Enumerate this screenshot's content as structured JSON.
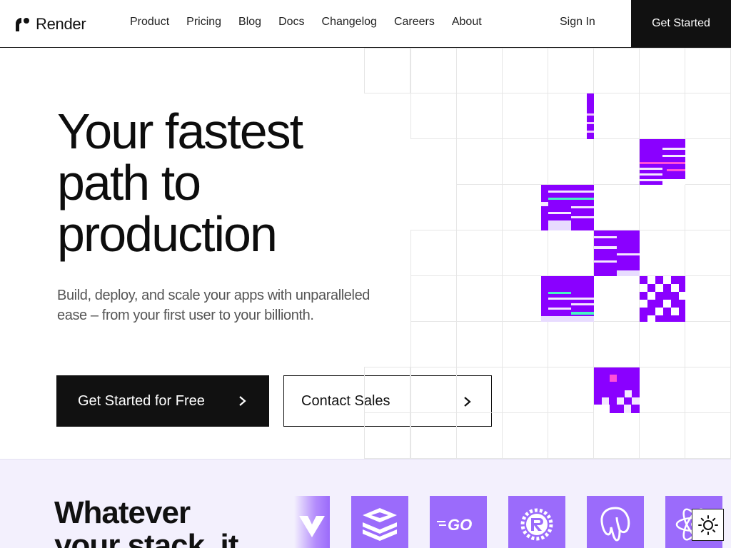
{
  "brand": {
    "name": "Render"
  },
  "nav": {
    "links": [
      "Product",
      "Pricing",
      "Blog",
      "Docs",
      "Changelog",
      "Careers",
      "About"
    ],
    "sign_in": "Sign In",
    "get_started": "Get Started"
  },
  "hero": {
    "title_lines": [
      "Your fastest",
      "path to",
      "production"
    ],
    "subtitle": "Build, deploy, and scale your apps with unparalleled ease – from your first user to your billionth.",
    "primary_cta": "Get Started for Free",
    "secondary_cta": "Contact Sales"
  },
  "stack": {
    "title_lines": [
      "Whatever",
      "your stack, it"
    ],
    "icons": [
      "vue-icon",
      "redis-icon",
      "go-icon",
      "rust-icon",
      "postgres-icon",
      "react-icon"
    ],
    "go_label": "GO"
  },
  "colors": {
    "accent": "#8a00ff",
    "tile": "#9b6bfb",
    "section_bg": "#f3f0fd"
  }
}
